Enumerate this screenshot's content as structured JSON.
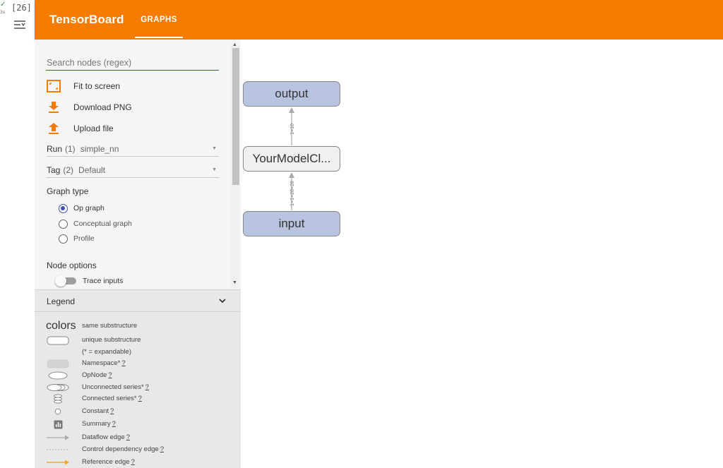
{
  "notebook": {
    "check": "✓",
    "exec_time": "3s",
    "cell_count": "[26]"
  },
  "header": {
    "title": "TensorBoard",
    "tab": "GRAPHS",
    "color": "#f57c00"
  },
  "sidebar": {
    "search_placeholder": "Search nodes (regex)",
    "actions": [
      {
        "label": "Fit to screen",
        "icon": "fit-screen-icon"
      },
      {
        "label": "Download PNG",
        "icon": "download-icon"
      },
      {
        "label": "Upload file",
        "icon": "upload-icon"
      }
    ],
    "run": {
      "label": "Run",
      "count": "(1)",
      "value": "simple_nn"
    },
    "tag": {
      "label": "Tag",
      "count": "(2)",
      "value": "Default"
    },
    "graph_type": {
      "title": "Graph type",
      "options": [
        "Op graph",
        "Conceptual graph",
        "Profile"
      ],
      "selected": "Op graph"
    },
    "node_options": {
      "title": "Node options",
      "trace_inputs_label": "Trace inputs",
      "trace_inputs_on": false
    }
  },
  "legend": {
    "title": "Legend",
    "items": [
      {
        "symbol": "colors",
        "text": "same substructure",
        "q": ""
      },
      {
        "symbol": "rounded-rect",
        "text": "unique substructure",
        "q": ""
      },
      {
        "symbol": "",
        "text": "(* = expandable)",
        "q": ""
      },
      {
        "symbol": "namespace",
        "text": "Namespace*",
        "q": "?"
      },
      {
        "symbol": "opnode",
        "text": "OpNode",
        "q": "?"
      },
      {
        "symbol": "unconnected-series",
        "text": "Unconnected series*",
        "q": "?"
      },
      {
        "symbol": "connected-series",
        "text": "Connected series*",
        "q": "?"
      },
      {
        "symbol": "constant",
        "text": "Constant",
        "q": "?"
      },
      {
        "symbol": "summary",
        "text": "Summary",
        "q": "?"
      },
      {
        "symbol": "dataflow-edge",
        "text": "Dataflow edge",
        "q": "?"
      },
      {
        "symbol": "control-edge",
        "text": "Control dependency edge",
        "q": "?"
      },
      {
        "symbol": "reference-edge",
        "text": "Reference edge",
        "q": "?"
      }
    ]
  },
  "graph": {
    "nodes": {
      "output": "output",
      "model": "YourModelCl...",
      "input": "input"
    },
    "edges": {
      "model_to_output": "1×10",
      "input_to_model": "1×1×28×28"
    },
    "op_color": "#b8c3df"
  }
}
